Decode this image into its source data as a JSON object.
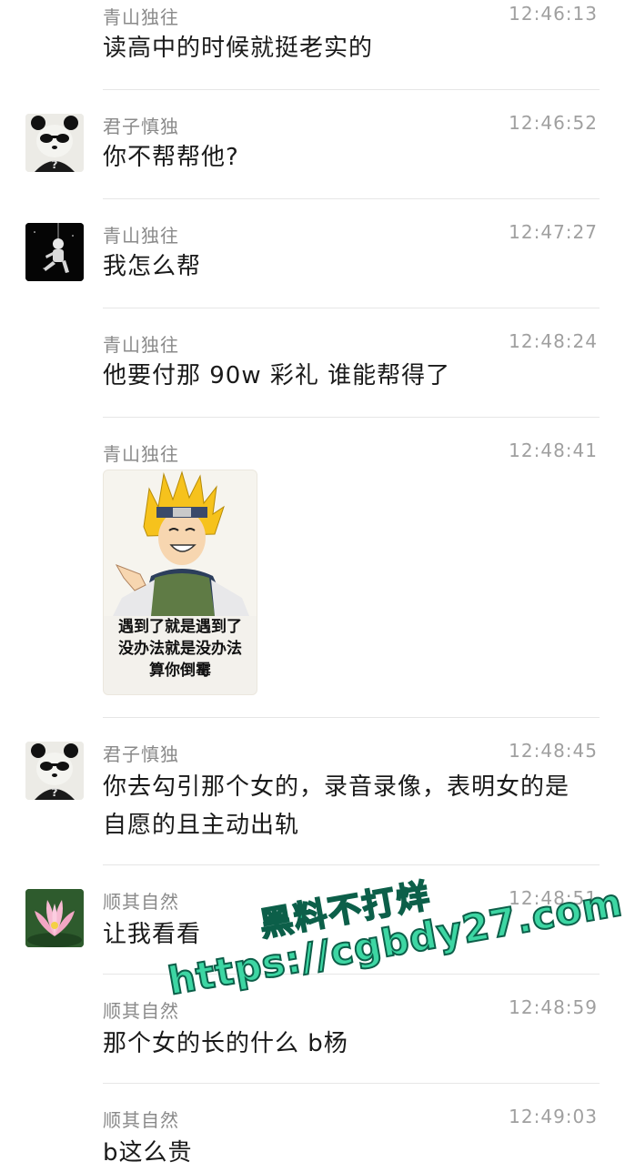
{
  "messages": [
    {
      "sender": "青山独往",
      "time": "12:46:13",
      "text": "读高中的时候就挺老实的"
    },
    {
      "sender": "君子慎独",
      "time": "12:46:52",
      "text": "你不帮帮他?"
    },
    {
      "sender": "青山独往",
      "time": "12:47:27",
      "text": "我怎么帮"
    },
    {
      "sender": "青山独往",
      "time": "12:48:24",
      "text": "他要付那 90w 彩礼 谁能帮得了"
    },
    {
      "sender": "青山独往",
      "time": "12:48:41",
      "sticker": {
        "lines": [
          "遇到了就是遇到了",
          "没办法就是没办法",
          "算你倒霉"
        ]
      }
    },
    {
      "sender": "君子慎独",
      "time": "12:48:45",
      "text_lines": [
        "你去勾引那个女的，录音录像，表明女的是",
        "自愿的且主动出轨"
      ]
    },
    {
      "sender": "顺其自然",
      "time": "12:48:51",
      "text": "让我看看"
    },
    {
      "sender": "顺其自然",
      "time": "12:48:59",
      "text": "那个女的长的什么 b杨"
    },
    {
      "sender": "顺其自然",
      "time": "12:49:03",
      "text": "b这么贵"
    }
  ],
  "avatars": {
    "junzi": "panda-avatar-icon",
    "qingshan": "astronaut-avatar-icon",
    "shunqi": "lotus-avatar-icon"
  },
  "overlay": {
    "line1": "黑料不打烊",
    "line2": "https://cgbdy27.com"
  },
  "colors": {
    "overlay_fill": "#3dd6a3",
    "overlay_stroke": "#0c5f49"
  }
}
